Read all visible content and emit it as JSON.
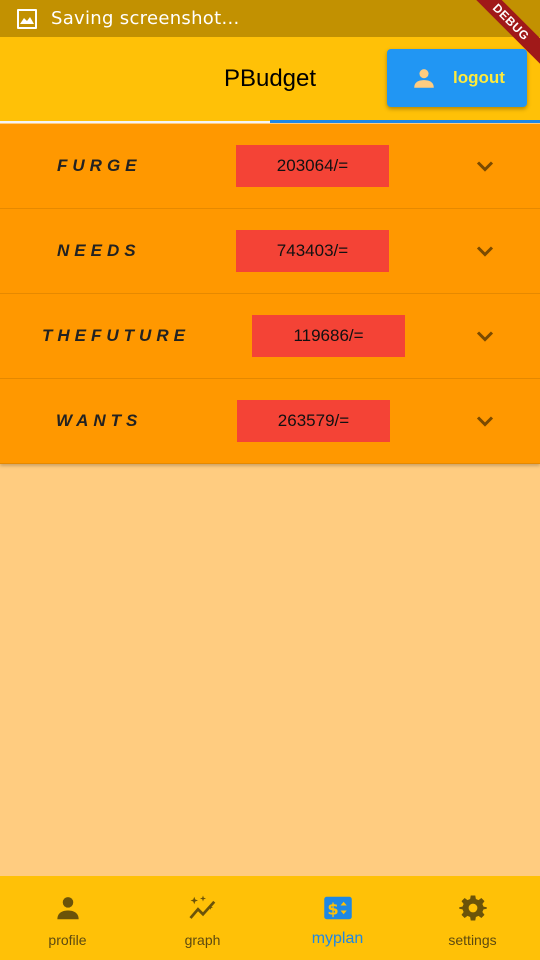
{
  "status_bar": {
    "text": "Saving screenshot...",
    "icon": "image-icon"
  },
  "debug_banner": "DEBUG",
  "app_bar": {
    "title": "PBudget",
    "logout": {
      "label": "logout",
      "icon": "person-icon"
    }
  },
  "plans": [
    {
      "name": "FURGE",
      "amount": "203064/="
    },
    {
      "name": "NEEDS",
      "amount": "743403/="
    },
    {
      "name": "THEFUTURE",
      "amount": "119686/="
    },
    {
      "name": "WANTS",
      "amount": "263579/="
    }
  ],
  "bottom_nav": [
    {
      "label": "profile",
      "icon": "person-icon",
      "active": false
    },
    {
      "label": "graph",
      "icon": "auto-graph-icon",
      "active": false
    },
    {
      "label": "myplan",
      "icon": "price-change-icon",
      "active": true
    },
    {
      "label": "settings",
      "icon": "gear-icon",
      "active": false
    }
  ],
  "colors": {
    "status_bar": "#c29101",
    "app_bar": "#ffc107",
    "row": "#ff9800",
    "amount_box": "#f44336",
    "logout_button": "#2196f3",
    "active_nav": "#1e88e5",
    "background": "#ffcc80"
  }
}
